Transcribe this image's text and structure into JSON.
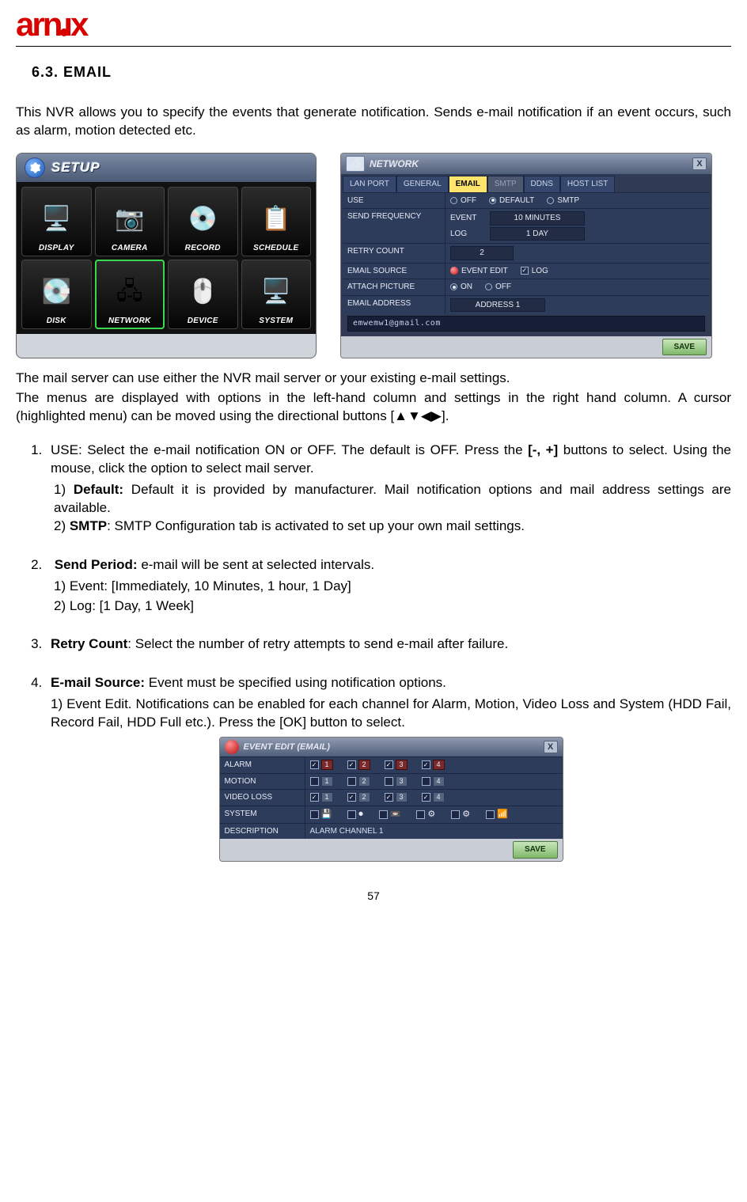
{
  "logo_text": "arnix",
  "section_heading": "6.3.  EMAIL",
  "intro_paragraph": "This NVR allows you to specify the events that generate notification. Sends e-mail notification if an event occurs, such as alarm, motion detected etc.",
  "setup": {
    "title": "SETUP",
    "tiles": [
      {
        "label": "DISPLAY",
        "icon": "🖥️"
      },
      {
        "label": "CAMERA",
        "icon": "📷"
      },
      {
        "label": "RECORD",
        "icon": "💿"
      },
      {
        "label": "SCHEDULE",
        "icon": "📋"
      },
      {
        "label": "DISK",
        "icon": "💽"
      },
      {
        "label": "NETWORK",
        "icon": "🖧",
        "selected": true
      },
      {
        "label": "DEVICE",
        "icon": "🖱️"
      },
      {
        "label": "SYSTEM",
        "icon": "🖥️"
      }
    ]
  },
  "network_dialog": {
    "title": "NETWORK",
    "tabs": [
      "LAN PORT",
      "GENERAL",
      "EMAIL",
      "SMTP",
      "DDNS",
      "HOST LIST"
    ],
    "active_tab": "EMAIL",
    "rows": {
      "use_label": "USE",
      "use_options": [
        "OFF",
        "DEFAULT",
        "SMTP"
      ],
      "use_selected": "DEFAULT",
      "send_freq_label": "SEND FREQUENCY",
      "send_freq_event_label": "EVENT",
      "send_freq_event_value": "10 MINUTES",
      "send_freq_log_label": "LOG",
      "send_freq_log_value": "1 DAY",
      "retry_label": "RETRY COUNT",
      "retry_value": "2",
      "source_label": "EMAIL SOURCE",
      "source_event_edit": "EVENT EDIT",
      "source_log_label": "LOG",
      "source_log_checked": true,
      "attach_label": "ATTACH PICTURE",
      "attach_options": [
        "ON",
        "OFF"
      ],
      "attach_selected": "ON",
      "addr_label": "EMAIL ADDRESS",
      "addr_field_label": "ADDRESS 1",
      "addr_value": "emwemw1@gmail.com"
    },
    "save_label": "SAVE"
  },
  "para_after_screens_1": "The mail server can use either the NVR mail server or your existing e-mail settings.",
  "para_after_screens_2": "The menus are displayed with options in the left-hand column and settings in the right hand column.    A cursor (highlighted menu) can be moved using the directional buttons [▲▼◀▶].",
  "list": {
    "item1_lead": "USE: Select the e-mail notification ON or OFF. The default is OFF. Press the ",
    "item1_bold": "[-, +]",
    "item1_tail": " buttons to select. Using the mouse, click the option to select mail server.",
    "item1_sub1_lead": "1) ",
    "item1_sub1_bold": "Default:",
    "item1_sub1_tail": " Default it is provided by manufacturer. Mail notification options and mail address settings are available.",
    "item1_sub2_lead": "2) ",
    "item1_sub2_bold": "SMTP",
    "item1_sub2_tail": ": SMTP Configuration tab is activated to set up your own mail settings.",
    "item2_bold": "Send Period:",
    "item2_tail": " e-mail will be sent at selected intervals.",
    "item2_sub1": "1) Event:    [Immediately, 10 Minutes, 1 hour, 1 Day]",
    "item2_sub2": "2) Log:       [1 Day, 1 Week]",
    "item3_bold": "Retry Count",
    "item3_tail": ": Select the number of retry attempts to send e-mail after failure.",
    "item4_bold": "E-mail Source:",
    "item4_tail": " Event must be specified using notification options.",
    "item4_sub": "1) Event Edit. Notifications can be enabled for each channel for Alarm, Motion, Video Loss and System (HDD Fail, Record Fail, HDD Full etc.). Press the [OK] button to select."
  },
  "event_dialog": {
    "title": "EVENT EDIT (EMAIL)",
    "rows": [
      {
        "label": "ALARM",
        "type": "red",
        "checks": [
          true,
          true,
          true,
          true
        ]
      },
      {
        "label": "MOTION",
        "type": "gray",
        "checks": [
          false,
          false,
          false,
          false
        ]
      },
      {
        "label": "VIDEO LOSS",
        "type": "gray",
        "checks": [
          true,
          true,
          true,
          true
        ]
      },
      {
        "label": "SYSTEM",
        "type": "sys"
      }
    ],
    "desc_label": "DESCRIPTION",
    "desc_value": "ALARM CHANNEL 1",
    "save_label": "SAVE"
  },
  "page_number": "57"
}
